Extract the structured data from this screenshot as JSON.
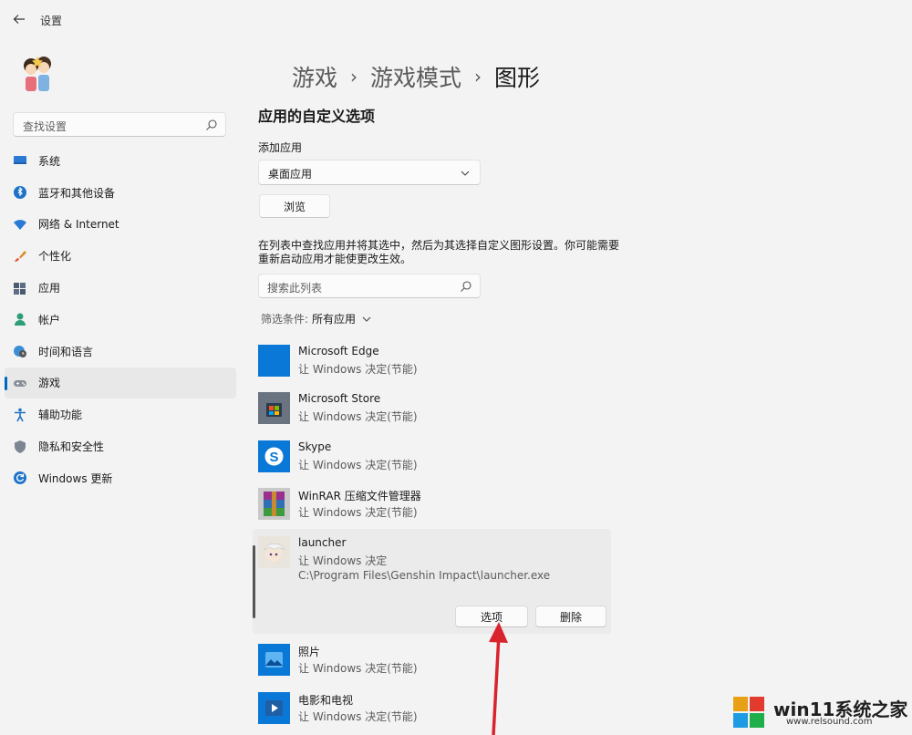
{
  "window": {
    "title": "设置"
  },
  "sidebar": {
    "search_placeholder": "查找设置",
    "items": [
      {
        "label": "系统",
        "icon": "monitor-icon"
      },
      {
        "label": "蓝牙和其他设备",
        "icon": "bluetooth-icon"
      },
      {
        "label": "网络 & Internet",
        "icon": "wifi-icon"
      },
      {
        "label": "个性化",
        "icon": "brush-icon"
      },
      {
        "label": "应用",
        "icon": "apps-icon"
      },
      {
        "label": "帐户",
        "icon": "person-icon"
      },
      {
        "label": "时间和语言",
        "icon": "globe-clock-icon"
      },
      {
        "label": "游戏",
        "icon": "gamepad-icon",
        "selected": true
      },
      {
        "label": "辅助功能",
        "icon": "accessibility-icon"
      },
      {
        "label": "隐私和安全性",
        "icon": "shield-icon"
      },
      {
        "label": "Windows 更新",
        "icon": "update-icon"
      }
    ]
  },
  "main": {
    "breadcrumb": [
      "游戏",
      "游戏模式",
      "图形"
    ],
    "section_title": "应用的自定义选项",
    "add_app_label": "添加应用",
    "dropdown_value": "桌面应用",
    "browse_label": "浏览",
    "description": "在列表中查找应用并将其选中，然后为其选择自定义图形设置。你可能需要重新启动应用才能使更改生效。",
    "list_search_placeholder": "搜索此列表",
    "filter_label": "筛选条件:",
    "filter_value": "所有应用",
    "apps": [
      {
        "name": "Microsoft Edge",
        "status": "让 Windows 决定(节能)",
        "icon": "edge-icon"
      },
      {
        "name": "Microsoft Store",
        "status": "让 Windows 决定(节能)",
        "icon": "store-icon"
      },
      {
        "name": "Skype",
        "status": "让 Windows 决定(节能)",
        "icon": "skype-icon"
      },
      {
        "name": "WinRAR 压缩文件管理器",
        "status": "让 Windows 决定(节能)",
        "icon": "winrar-icon"
      },
      {
        "name": "launcher",
        "status": "让 Windows 决定",
        "path": "C:\\Program Files\\Genshin Impact\\launcher.exe",
        "icon": "launcher-icon",
        "expanded": true
      },
      {
        "name": "照片",
        "status": "让 Windows 决定(节能)",
        "icon": "photos-icon"
      },
      {
        "name": "电影和电视",
        "status": "让 Windows 决定(节能)",
        "icon": "movies-tv-icon"
      }
    ],
    "options_button": "选项",
    "delete_button": "删除"
  },
  "watermark": {
    "text": "win11系统之家",
    "url": "www.relsound.com"
  },
  "colors": {
    "accent": "#0067c0",
    "arrow": "#d9232d",
    "app_tile": "#0a78d7"
  }
}
